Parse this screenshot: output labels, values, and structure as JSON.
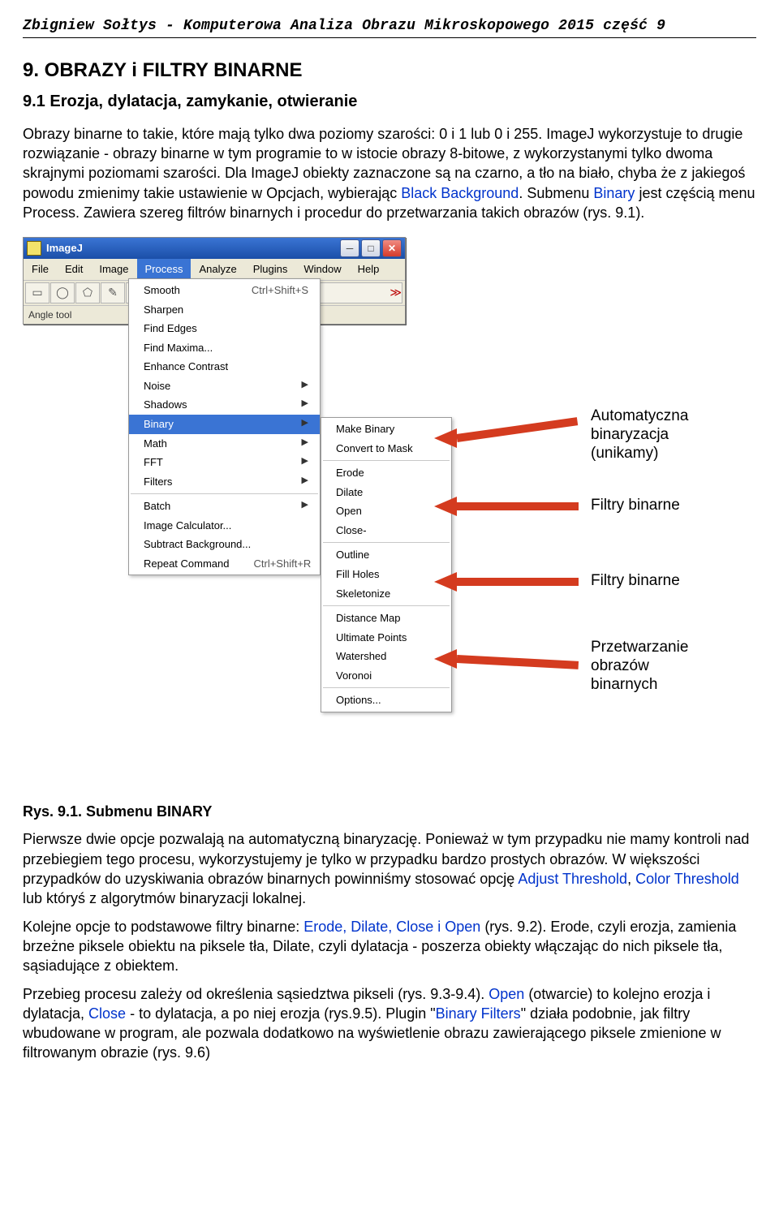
{
  "header": "Zbigniew Sołtys -  Komputerowa Analiza Obrazu Mikroskopowego 2015 część 9",
  "section_title": "9. OBRAZY i FILTRY BINARNE",
  "subsection_title": "9.1 Erozja, dylatacja, zamykanie, otwieranie",
  "para1_a": "Obrazy binarne to takie, które mają tylko dwa poziomy szarości: 0 i 1 lub 0 i 255. ImageJ wykorzystuje to drugie rozwiązanie - obrazy binarne w tym programie to w istocie obrazy 8-bitowe, z wykorzystanymi tylko dwoma skrajnymi poziomami szarości. Dla ImageJ obiekty zaznaczone są na czarno, a tło na biało, chyba że z jakiegoś powodu zmienimy takie ustawienie w Opcjach, wybierając ",
  "para1_b": "Black Background",
  "para1_c": ".",
  "para2_a": "Submenu ",
  "para2_b": "Binary",
  "para2_c": " jest częścią menu Process. Zawiera szereg filtrów binarnych i procedur do przetwarzania takich obrazów (rys. 9.1).",
  "ij": {
    "title": "ImageJ",
    "menu": [
      "File",
      "Edit",
      "Image",
      "Process",
      "Analyze",
      "Plugins",
      "Window",
      "Help"
    ],
    "menu_selected": "Process",
    "status": "Angle tool",
    "process_menu": [
      {
        "label": "Smooth",
        "shortcut": "Ctrl+Shift+S"
      },
      {
        "label": "Sharpen"
      },
      {
        "label": "Find Edges"
      },
      {
        "label": "Find Maxima..."
      },
      {
        "label": "Enhance Contrast"
      },
      {
        "label": "Noise",
        "sub": true
      },
      {
        "label": "Shadows",
        "sub": true
      },
      {
        "label": "Binary",
        "sub": true,
        "selected": true
      },
      {
        "label": "Math",
        "sub": true
      },
      {
        "label": "FFT",
        "sub": true
      },
      {
        "label": "Filters",
        "sub": true
      },
      {
        "sep": true
      },
      {
        "label": "Batch",
        "sub": true
      },
      {
        "label": "Image Calculator..."
      },
      {
        "label": "Subtract Background..."
      },
      {
        "label": "Repeat Command",
        "shortcut": "Ctrl+Shift+R"
      }
    ],
    "binary_menu": [
      {
        "label": "Make Binary"
      },
      {
        "label": "Convert to Mask"
      },
      {
        "sep": true
      },
      {
        "label": "Erode"
      },
      {
        "label": "Dilate"
      },
      {
        "label": "Open"
      },
      {
        "label": "Close-"
      },
      {
        "sep": true
      },
      {
        "label": "Outline"
      },
      {
        "label": "Fill Holes"
      },
      {
        "label": "Skeletonize"
      },
      {
        "sep": true
      },
      {
        "label": "Distance Map"
      },
      {
        "label": "Ultimate Points"
      },
      {
        "label": "Watershed"
      },
      {
        "label": "Voronoi"
      },
      {
        "sep": true
      },
      {
        "label": "Options..."
      }
    ]
  },
  "annot1": "Automatyczna\nbinaryzacja\n(unikamy)",
  "annot2": "Filtry binarne",
  "annot3": "Filtry binarne",
  "annot4": "Przetwarzanie\nobrazów\nbinarnych",
  "fig_caption": "Rys. 9.1. Submenu BINARY",
  "para3_a": "Pierwsze dwie opcje pozwalają na automatyczną binaryzację. Ponieważ w tym przypadku nie mamy kontroli nad przebiegiem tego procesu, wykorzystujemy je tylko w przypadku bardzo prostych obrazów. W większości przypadków do uzyskiwania obrazów binarnych powinniśmy stosować opcję ",
  "para3_b": "Adjust Threshold",
  "para3_c": ", ",
  "para3_d": "Color Threshold",
  "para3_e": " lub któryś z algorytmów binaryzacji lokalnej.",
  "para4_a": "Kolejne opcje to podstawowe filtry binarne: ",
  "para4_b": "Erode, Dilate, Close i Open",
  "para4_c": " (rys. 9.2). Erode, czyli erozja, zamienia brzeżne piksele obiektu na piksele tła, Dilate, czyli dylatacja - poszerza obiekty włączając do nich piksele tła, sąsiadujące z obiektem.",
  "para5_a": "Przebieg procesu zależy od określenia sąsiedztwa pikseli (rys. 9.3-9.4). ",
  "para5_b": "Open",
  "para5_c": " (otwarcie) to kolejno erozja i dylatacja, ",
  "para5_d": "Close",
  "para5_e": " - to dylatacja, a po niej erozja (rys.9.5). Plugin \"",
  "para5_f": "Binary Filters",
  "para5_g": "\" działa podobnie, jak filtry wbudowane w program, ale pozwala dodatkowo na wyświetlenie obrazu zawierającego piksele zmienione w filtrowanym obrazie (rys. 9.6)"
}
